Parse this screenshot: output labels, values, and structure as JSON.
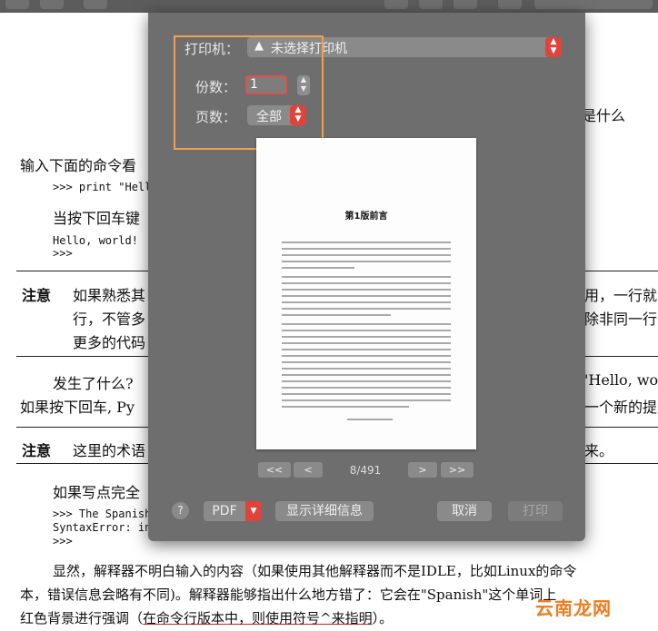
{
  "document": {
    "fragment_right": "么是什么",
    "input_prompt": "输入下面的命令看",
    "code_print": ">>> print \"Hello",
    "enter_text": "当按下回车键",
    "output_hello": "Hello, world!",
    "prompt_after": ">>>",
    "note1_label": "注意",
    "note1_line1_left": "如果熟悉其",
    "note1_line1_right": "用，一行就",
    "note1_line2_left": "行，不管多",
    "note1_line2_right": "除非同一行",
    "note1_line3": "更多的代码",
    "happened_left": "发生了什么?",
    "happened_right": "'Hello, wor",
    "enter_left": "如果按下回车, Py",
    "enter_right": "一个新的提",
    "note2_label": "注意",
    "note2_left": "这里的术语",
    "note2_right": "来。",
    "if_write": "如果写点完全",
    "code_spanish": ">>> The Spanish",
    "syntax_error": "SyntaxError: inv",
    "prompt_end": ">>>",
    "para1": "显然，解释器不明白输入的内容（如果使用其他解释器而不是IDLE，比如Linux的命令",
    "para2": "本，错误信息会略有不同)。解释器能够指出什么地方错了：它会在\"Spanish\"这个单词上",
    "para3_prefix": "红色背景进行强调（",
    "para3_emph": "在命令行版本中，则使用符号^来指明",
    "para3_suffix": "）。"
  },
  "print_dialog": {
    "printer_label": "打印机：",
    "printer_value": "未选择打印机",
    "printer_warning_icon": "warning-triangle-icon",
    "copies_label": "份数：",
    "copies_value": "1",
    "pages_label": "页数：",
    "pages_value": "全部",
    "preview_title": "第1版前言",
    "first_page_label": "<<",
    "prev_page_label": "<",
    "page_indicator": "8/491",
    "next_page_label": ">",
    "last_page_label": ">>",
    "help_label": "?",
    "pdf_label": "PDF",
    "show_details_label": "显示详细信息",
    "cancel_label": "取消",
    "print_label": "打印"
  },
  "watermark": "云南龙网",
  "colors": {
    "dialog_bg": "#6e6e6e",
    "accent_red": "#e0433a",
    "highlight_orange": "#f0a050",
    "watermark_orange": "#ef7b1d"
  }
}
